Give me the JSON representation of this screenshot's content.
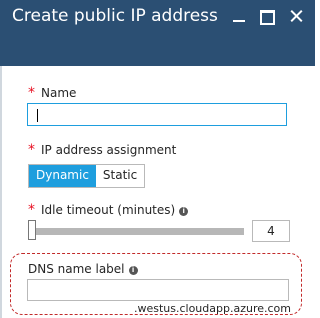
{
  "window": {
    "title": "Create public IP address"
  },
  "form": {
    "name": {
      "label": "Name",
      "value": ""
    },
    "ip_assignment": {
      "label": "IP address assignment",
      "options": [
        "Dynamic",
        "Static"
      ],
      "selected": "Dynamic"
    },
    "idle_timeout": {
      "label": "Idle timeout (minutes)",
      "value": "4"
    },
    "dns": {
      "label": "DNS name label",
      "value": "",
      "suffix": ".westus.cloudapp.azure.com"
    }
  },
  "icons": {
    "info": "i"
  },
  "colors": {
    "titlebar": "#2b4f73",
    "accent": "#1e9ede",
    "required": "#e81123",
    "highlight_border": "#c22a2a"
  }
}
